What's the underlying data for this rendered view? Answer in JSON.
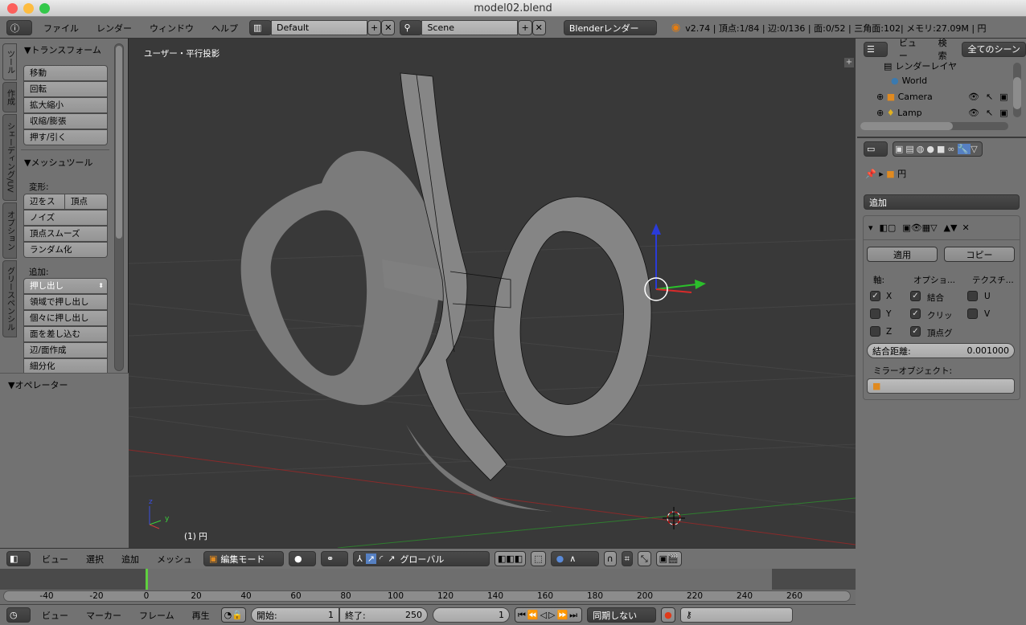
{
  "window": {
    "title": "model02.blend"
  },
  "info_header": {
    "menus": [
      "ファイル",
      "レンダー",
      "ウィンドウ",
      "ヘルプ"
    ],
    "layout": "Default",
    "scene": "Scene",
    "render_engine": "Blenderレンダー",
    "stats": "v2.74 | 頂点:1/84 | 辺:0/136 | 面:0/52 | 三角面:102| メモリ:27.09M | 円"
  },
  "tool_panel": {
    "tabs": [
      "ツール",
      "作成",
      "シェーディング/UV",
      "オプション",
      "グリースペンシル"
    ],
    "transform_title": "▼トランスフォーム",
    "transform_buttons": [
      "移動",
      "回転",
      "拡大縮小",
      "収縮/膨張",
      "押す/引く"
    ],
    "mesh_tools_title": "▼メッシュツール",
    "deform_label": "変形:",
    "deform_buttons": [
      "辺をス",
      "頂点",
      "ノイズ",
      "頂点スムーズ",
      "ランダム化"
    ],
    "add_label": "追加:",
    "extrude_select": "押し出し",
    "add_buttons": [
      "領域で押し出し",
      "個々に押し出し",
      "面を差し込む",
      "辺/面作成",
      "細分化"
    ],
    "operator_title": "▼オペレーター"
  },
  "viewport": {
    "view_label": "ユーザー・平行投影",
    "object_label": "(1) 円",
    "axis_labels": {
      "z": "z",
      "y": "y"
    }
  },
  "outliner": {
    "menus": [
      "ビュー",
      "検索"
    ],
    "filter": "全てのシーン",
    "items": [
      "レンダーレイヤ",
      "World",
      "Camera",
      "Lamp"
    ]
  },
  "properties": {
    "breadcrumb": "円",
    "add_modifier": "追加",
    "apply": "適用",
    "copy": "コピー",
    "axis_label": "軸:",
    "options_label": "オプショ...",
    "texture_label": "テクスチ...",
    "axes": [
      {
        "label": "X",
        "checked": true
      },
      {
        "label": "Y",
        "checked": false
      },
      {
        "label": "Z",
        "checked": false
      }
    ],
    "options": [
      {
        "label": "結合",
        "checked": true
      },
      {
        "label": "クリッ",
        "checked": true
      },
      {
        "label": "頂点グ",
        "checked": true
      }
    ],
    "textures": [
      {
        "label": "U",
        "checked": false
      },
      {
        "label": "V",
        "checked": false
      }
    ],
    "merge_label": "結合距離:",
    "merge_value": "0.001000",
    "mirror_object_label": "ミラーオブジェクト:"
  },
  "view3d_header": {
    "menus": [
      "ビュー",
      "選択",
      "追加",
      "メッシュ"
    ],
    "mode": "編集モード",
    "orientation": "グローバル"
  },
  "timeline": {
    "ticks": [
      "-40",
      "-20",
      "0",
      "20",
      "40",
      "60",
      "80",
      "100",
      "120",
      "140",
      "160",
      "180",
      "200",
      "220",
      "240",
      "260"
    ],
    "current_frame": 0
  },
  "timeline_header": {
    "menus": [
      "ビュー",
      "マーカー",
      "フレーム",
      "再生"
    ],
    "start_label": "開始:",
    "start": "1",
    "end_label": "終了:",
    "end": "250",
    "frame": "1",
    "sync": "同期しない"
  },
  "colors": {
    "accent": "#5680c2",
    "viewport_bg": "#393939",
    "panel": "#727272"
  }
}
